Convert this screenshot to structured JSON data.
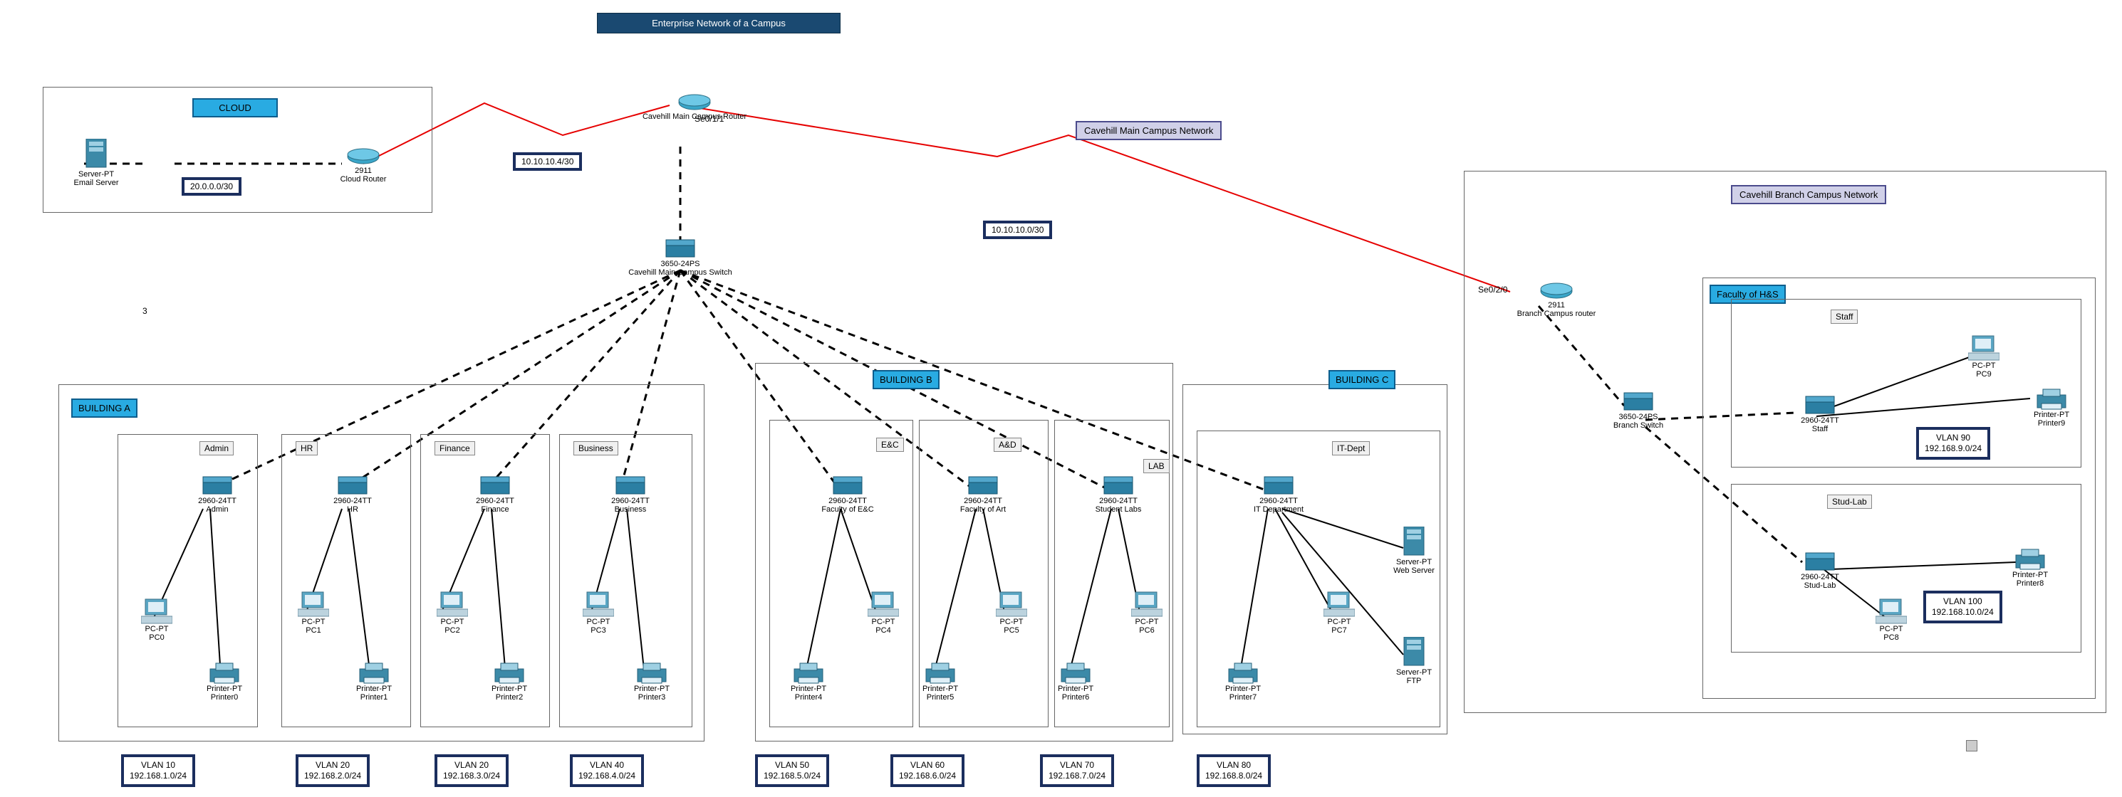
{
  "titles": {
    "enterprise": "Enterprise Network of a Campus",
    "cloud": "CLOUD",
    "main": "Cavehill Main Campus Network",
    "branch": "Cavehill Branch Campus Network",
    "bA": "BUILDING A",
    "bB": "BUILDING B",
    "bC": "BUILDING C",
    "hs": "Faculty of H&S",
    "groups": {
      "admin": "Admin",
      "hr": "HR",
      "fin": "Finance",
      "bus": "Business",
      "ec": "E&C",
      "ad": "A&D",
      "lab": "LAB",
      "it": "IT-Dept",
      "staff": "Staff",
      "stud": "Stud-Lab"
    }
  },
  "ports": {
    "se011": "Se0/1/1",
    "se020": "Se0/2/0"
  },
  "nets": {
    "cloud": "20.0.0.0/30",
    "main": "10.10.10.4/30",
    "branch": "10.10.10.0/30"
  },
  "num3": "3",
  "devices": {
    "email": {
      "l1": "Server-PT",
      "l2": "Email Server"
    },
    "cloudr": {
      "l1": "2911",
      "l2": "Cloud Router"
    },
    "mainr": {
      "l1": "Cavehill Main Campus Router"
    },
    "mainsw": {
      "l1": "3650-24PS",
      "l2": "Cavehill Main Campus Switch"
    },
    "branchr": {
      "l1": "2911",
      "l2": "Branch Campus router"
    },
    "branchsw": {
      "l1": "3650-24PS",
      "l2": "Branch Switch"
    },
    "sw": {
      "admin": "2960-24TT\nAdmin",
      "hr": "2960-24TT\nHR",
      "fin": "2960-24TT\nFinance",
      "bus": "2960-24TT\nBusiness",
      "ec": "2960-24TT\nFaculty of E&C",
      "ad": "2960-24TT\nFaculty of Art",
      "lab": "2960-24TT\nStudent Labs",
      "it": "2960-24TT\nIT Department",
      "staff": "2960-24TT\nStaff",
      "stud": "2960-24TT\nStud-Lab"
    },
    "pc": {
      "0": "PC-PT\nPC0",
      "1": "PC-PT\nPC1",
      "2": "PC-PT\nPC2",
      "3": "PC-PT\nPC3",
      "4": "PC-PT\nPC4",
      "5": "PC-PT\nPC5",
      "6": "PC-PT\nPC6",
      "7": "PC-PT\nPC7",
      "8": "PC-PT\nPC8",
      "9": "PC-PT\nPC9"
    },
    "pr": {
      "0": "Printer-PT\nPrinter0",
      "1": "Printer-PT\nPrinter1",
      "2": "Printer-PT\nPrinter2",
      "3": "Printer-PT\nPrinter3",
      "4": "Printer-PT\nPrinter4",
      "5": "Printer-PT\nPrinter5",
      "6": "Printer-PT\nPrinter6",
      "7": "Printer-PT\nPrinter7",
      "8": "Printer-PT\nPrinter8",
      "9": "Printer-PT\nPrinter9"
    },
    "srv": {
      "web": "Server-PT\nWeb Server",
      "ftp": "Server-PT\nFTP"
    }
  },
  "vlans": {
    "10": "VLAN 10\n192.168.1.0/24",
    "20": "VLAN 20\n192.168.2.0/24",
    "30": "VLAN 20\n192.168.3.0/24",
    "40": "VLAN 40\n192.168.4.0/24",
    "50": "VLAN 50\n192.168.5.0/24",
    "60": "VLAN 60\n192.168.6.0/24",
    "70": "VLAN 70\n192.168.7.0/24",
    "80": "VLAN 80\n192.168.8.0/24",
    "90": "VLAN 90\n192.168.9.0/24",
    "100": "VLAN 100\n192.168.10.0/24"
  }
}
